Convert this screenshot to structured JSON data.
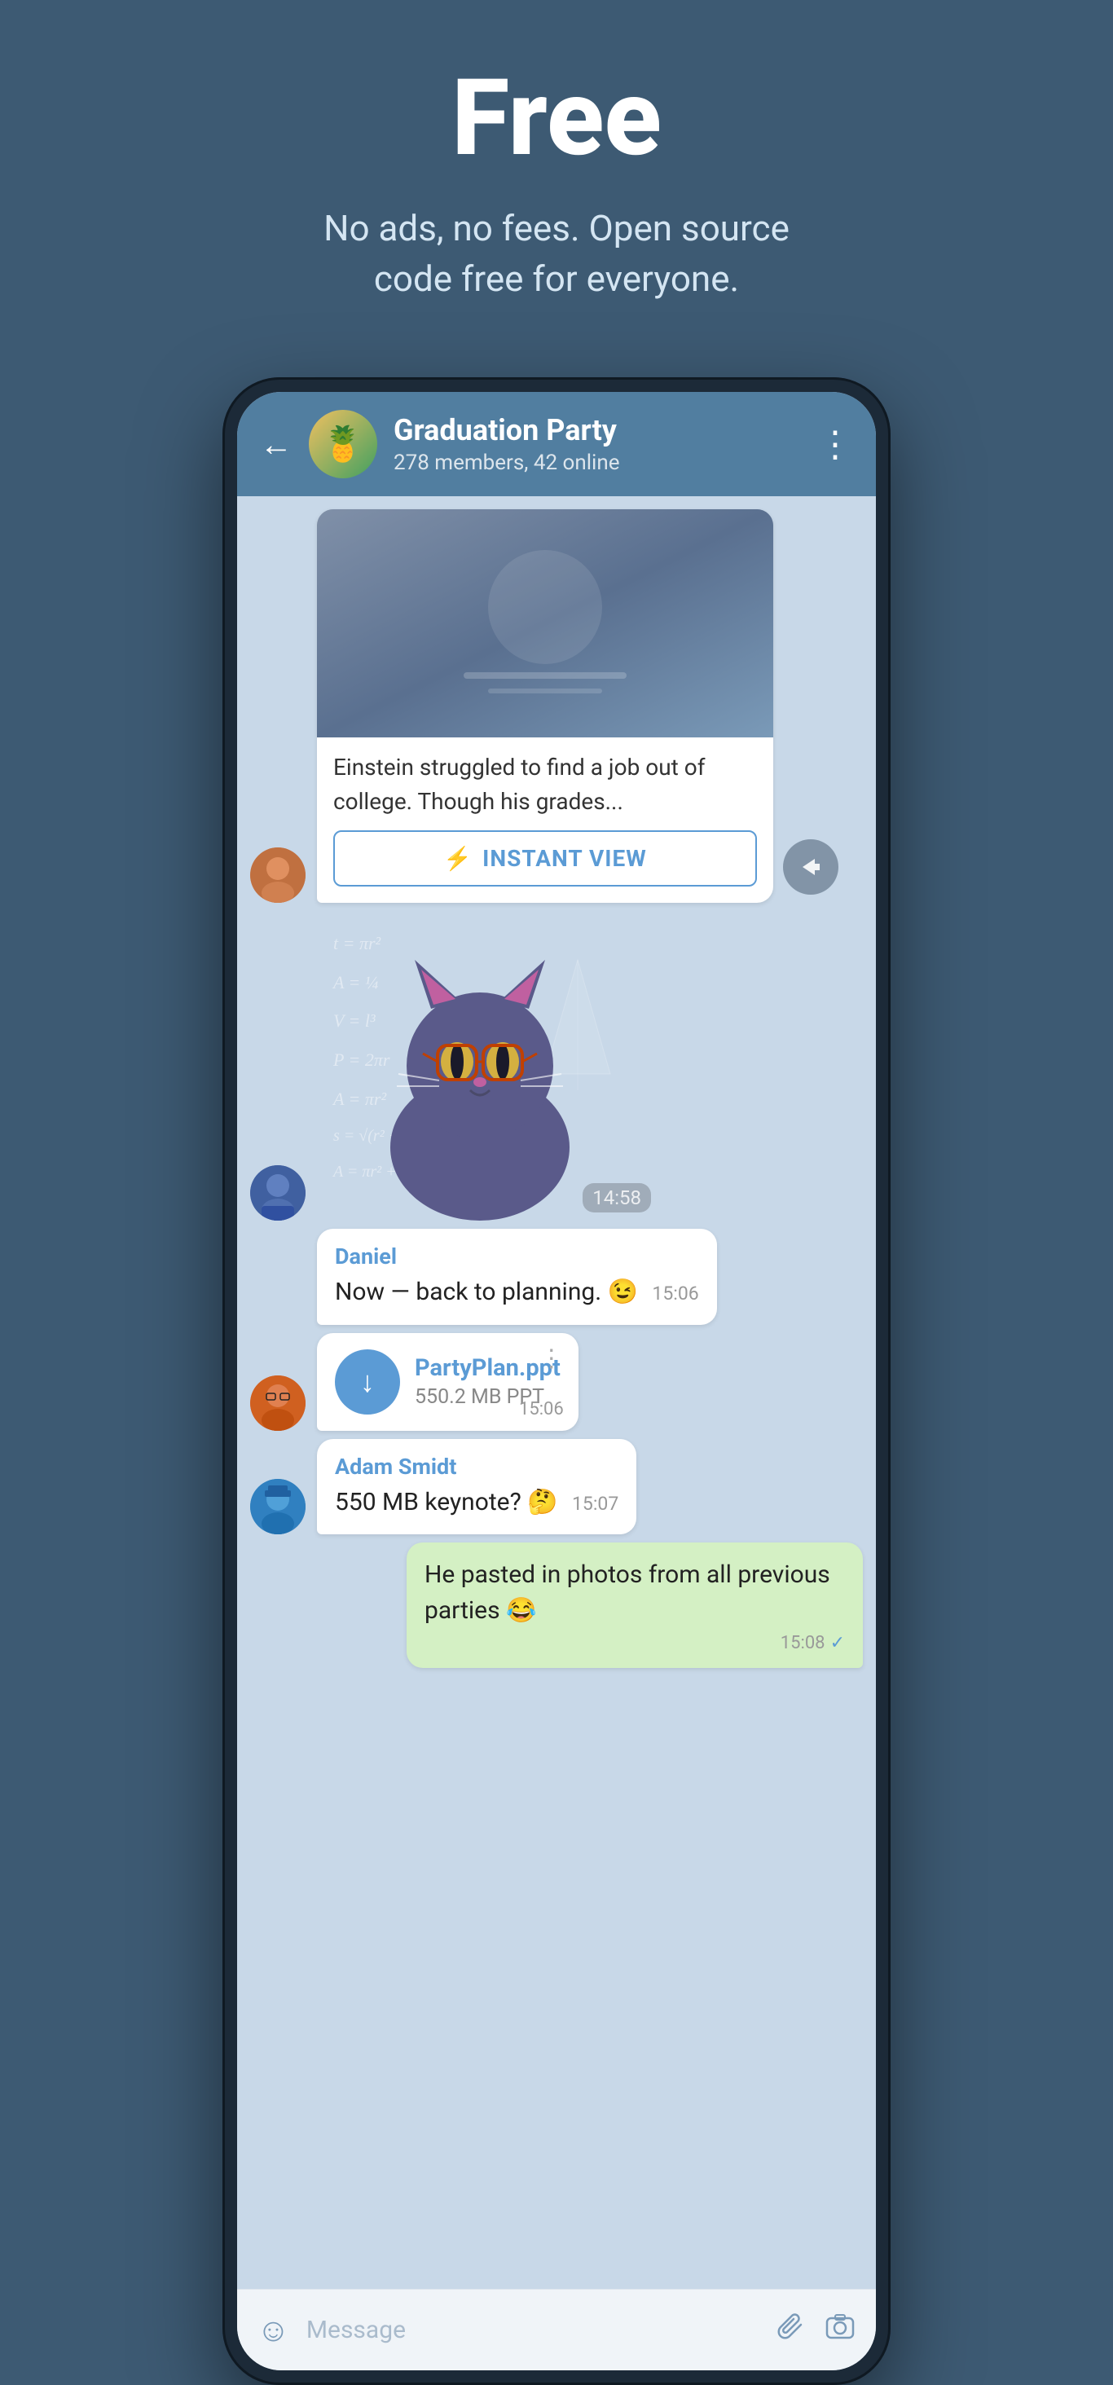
{
  "hero": {
    "title": "Free",
    "subtitle": "No ads, no fees. Open source\ncode free for everyone."
  },
  "phone": {
    "header": {
      "back_label": "←",
      "group_name": "Graduation Party",
      "group_status": "278 members, 42 online",
      "menu_icon": "⋮"
    },
    "messages": [
      {
        "id": "link-preview",
        "type": "link_preview",
        "sender": "user1",
        "preview_text": "Einstein struggled to find a job out of college. Though his grades...",
        "instant_view_label": "INSTANT VIEW",
        "lightning": "⚡"
      },
      {
        "id": "sticker-msg",
        "type": "sticker",
        "sender": "user2",
        "time": "14:58"
      },
      {
        "id": "text-daniel",
        "type": "text",
        "sender_name": "Daniel",
        "text": "Now — back to planning. 😉",
        "time": "15:06"
      },
      {
        "id": "file-partyplan",
        "type": "file",
        "sender": "user3",
        "file_name": "PartyPlan.ppt",
        "file_size": "550.2 MB PPT",
        "time": "15:06"
      },
      {
        "id": "text-adam",
        "type": "text",
        "sender_name": "Adam Smidt",
        "text": "550 MB keynote? 🤔",
        "time": "15:07"
      },
      {
        "id": "text-own",
        "type": "own",
        "text": "He pasted in photos from all previous parties 😂",
        "time": "15:08",
        "check": "✓"
      }
    ],
    "input_bar": {
      "placeholder": "Message",
      "emoji_icon": "☺",
      "attach_icon": "📎",
      "camera_icon": "⊙"
    }
  }
}
